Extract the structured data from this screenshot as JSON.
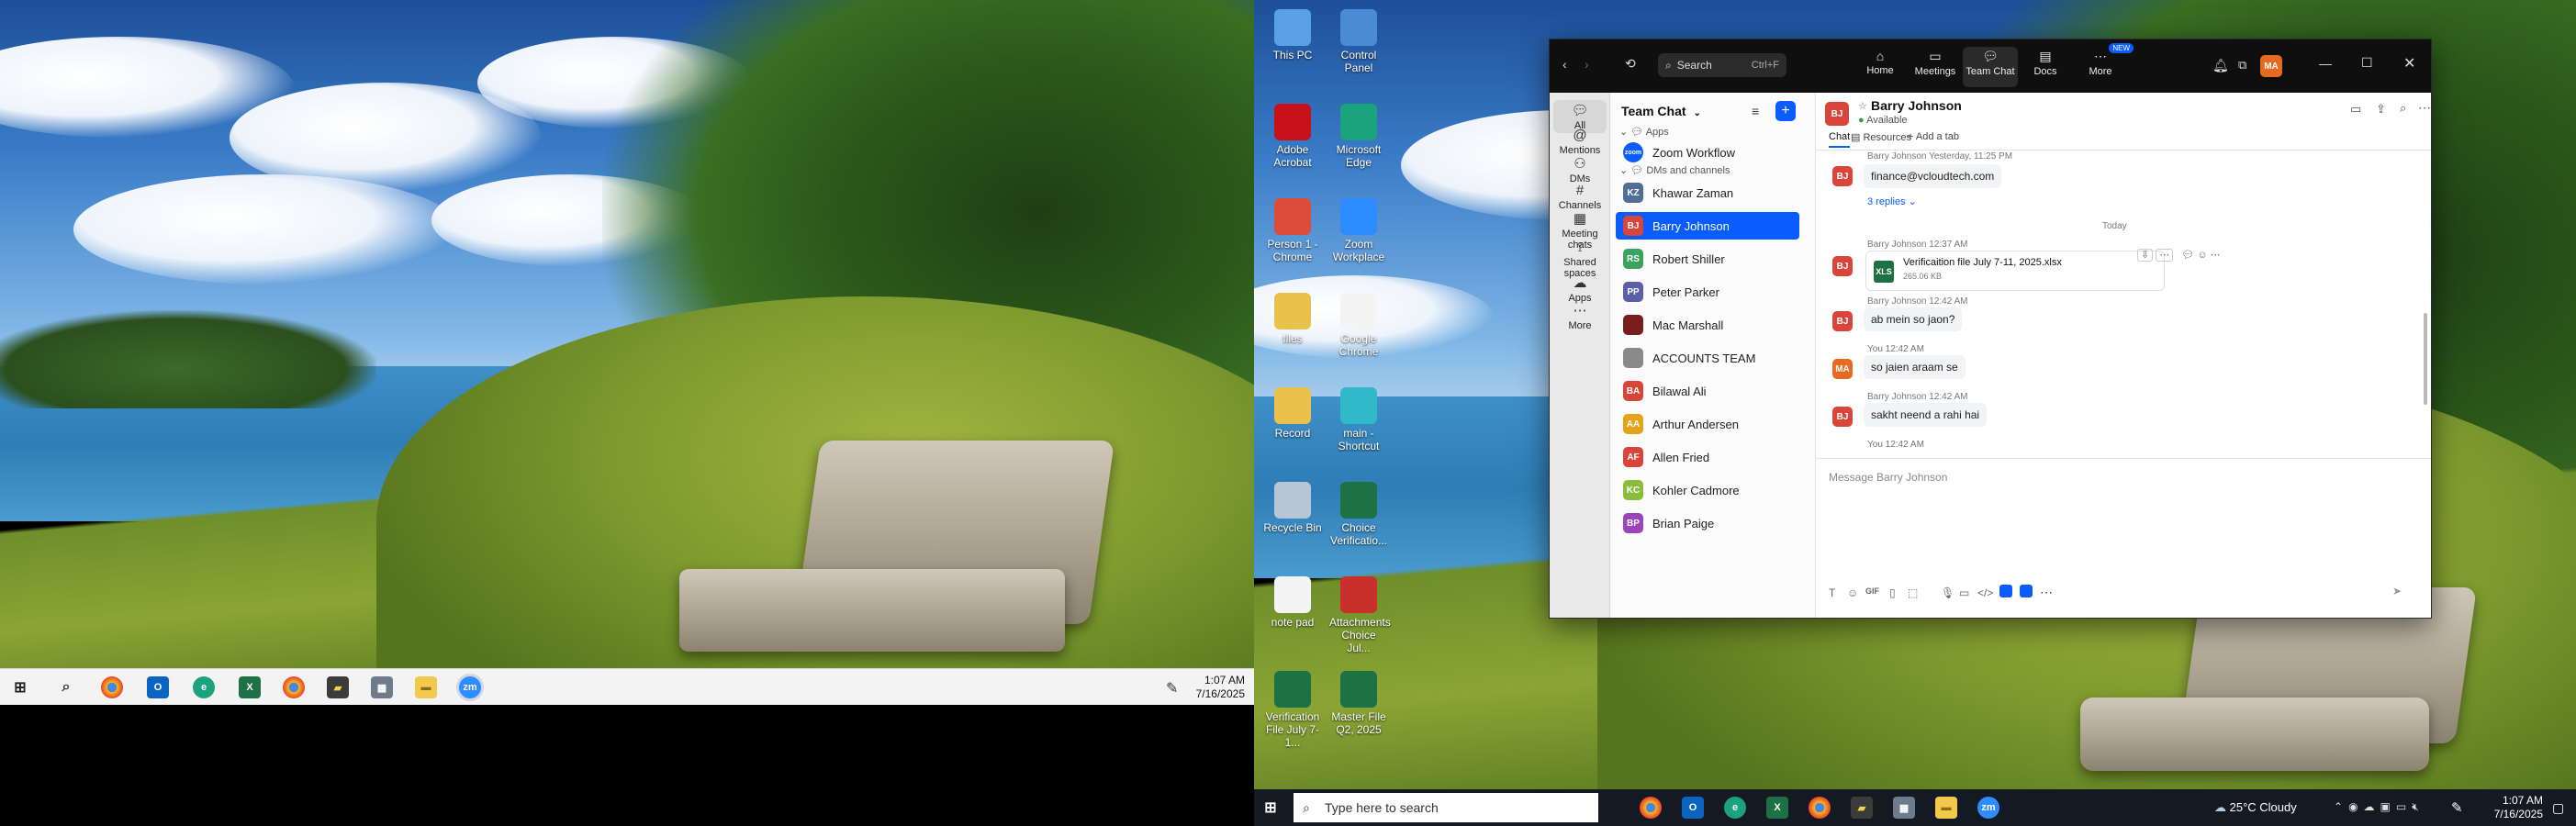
{
  "taskbar_left": {
    "clock_time": "1:07 AM",
    "clock_date": "7/16/2025",
    "apps": [
      {
        "icon": "windows-start-icon"
      },
      {
        "icon": "search-icon"
      },
      {
        "icon": "chrome-icon"
      },
      {
        "icon": "outlook-icon"
      },
      {
        "icon": "edge-icon"
      },
      {
        "icon": "excel-icon"
      },
      {
        "icon": "chrome-profile-icon"
      },
      {
        "icon": "sticky-notes-icon"
      },
      {
        "icon": "calculator-icon"
      },
      {
        "icon": "file-explorer-icon"
      },
      {
        "icon": "zoom-icon"
      }
    ]
  },
  "desktop_icons": [
    {
      "label": "This PC",
      "icon": "computer-icon",
      "color": "#5aa0e6"
    },
    {
      "label": "Control Panel",
      "icon": "control-panel-icon",
      "color": "#4b8bd6"
    },
    {
      "label": "Adobe Acrobat",
      "icon": "acrobat-icon",
      "color": "#c7101a"
    },
    {
      "label": "Microsoft Edge",
      "icon": "edge-icon",
      "color": "#1aa37c"
    },
    {
      "label": "Person 1 - Chrome",
      "icon": "chrome-icon",
      "color": "#dd4b39"
    },
    {
      "label": "Zoom Workplace",
      "icon": "zoom-icon",
      "color": "#2d8cff"
    },
    {
      "label": "files",
      "icon": "folder-icon",
      "color": "#e8c24a"
    },
    {
      "label": "Google Chrome",
      "icon": "document-icon",
      "color": "#f4f4f4"
    },
    {
      "label": "Record",
      "icon": "folder-icon",
      "color": "#e8c24a"
    },
    {
      "label": "main - Shortcut",
      "icon": "shortcut-icon",
      "color": "#2fb9c9"
    },
    {
      "label": "Recycle Bin",
      "icon": "recycle-bin-icon",
      "color": "#b7c6d6"
    },
    {
      "label": "Choice Verificatio...",
      "icon": "excel-icon",
      "color": "#1e7145"
    },
    {
      "label": "note pad",
      "icon": "notepad-icon",
      "color": "#f4f4f4"
    },
    {
      "label": "Attachments Choice Jul...",
      "icon": "folder-icon",
      "color": "#c9302c"
    },
    {
      "label": "Verification File July 7-1...",
      "icon": "excel-icon",
      "color": "#1e7145"
    },
    {
      "label": "Master File Q2, 2025",
      "icon": "excel-icon",
      "color": "#1e7145"
    }
  ],
  "taskbar_right": {
    "search_placeholder": "Type here to search",
    "weather": "25°C  Cloudy",
    "clock_time": "1:07 AM",
    "clock_date": "7/16/2025"
  },
  "zoom": {
    "search_label": "Search",
    "search_shortcut": "Ctrl+F",
    "nav_tabs": [
      {
        "label": "Home",
        "icon": "home-icon"
      },
      {
        "label": "Meetings",
        "icon": "video-icon"
      },
      {
        "label": "Team Chat",
        "icon": "chat-icon",
        "active": true
      },
      {
        "label": "Docs",
        "icon": "docs-icon"
      },
      {
        "label": "More",
        "icon": "more-icon",
        "badge": "NEW"
      }
    ],
    "profile_initials": "MA",
    "rail": [
      {
        "label": "All",
        "icon": "chat-bubble-icon"
      },
      {
        "label": "Mentions",
        "icon": "at-icon"
      },
      {
        "label": "DMs",
        "icon": "people-icon"
      },
      {
        "label": "Channels",
        "icon": "hash-icon"
      },
      {
        "label": "Meeting chats",
        "icon": "calendar-icon"
      },
      {
        "label": "Shared spaces",
        "icon": "shared-spaces-icon"
      },
      {
        "label": "Apps",
        "icon": "apps-icon"
      },
      {
        "label": "More",
        "icon": "ellipsis-icon"
      }
    ],
    "list_title": "Team Chat",
    "sections": {
      "apps": "Apps",
      "dms": "DMs and channels"
    },
    "app_item": "Zoom Workflow",
    "contacts": [
      {
        "name": "Khawar Zaman",
        "initials": "KZ",
        "color": "#4f6f95"
      },
      {
        "name": "Barry Johnson",
        "initials": "BJ",
        "color": "#d9453b",
        "active": true
      },
      {
        "name": "Robert Shiller",
        "initials": "RS",
        "color": "#3aa35d"
      },
      {
        "name": "Peter Parker",
        "initials": "PP",
        "color": "#5b5fa8"
      },
      {
        "name": "Mac Marshall",
        "initials": "",
        "color": "#7a1d1d"
      },
      {
        "name": "ACCOUNTS TEAM",
        "initials": "",
        "color": "#8a8a8a"
      },
      {
        "name": "Bilawal Ali",
        "initials": "BA",
        "color": "#d9453b"
      },
      {
        "name": "Arthur Andersen",
        "initials": "AA",
        "color": "#e6a21a"
      },
      {
        "name": "Allen Fried",
        "initials": "AF",
        "color": "#d9453b"
      },
      {
        "name": "Kohler Cadmore",
        "initials": "KC",
        "color": "#8bbd3c"
      },
      {
        "name": "Brian Paige",
        "initials": "BP",
        "color": "#9c45b8"
      }
    ],
    "chat": {
      "contact_name": "Barry Johnson",
      "contact_initials": "BJ",
      "status": "Available",
      "tabs": [
        "Chat",
        "Resources",
        "Add a tab"
      ],
      "messages": {
        "m0_meta": "Barry Johnson  Yesterday, 11:25 PM",
        "m0_text": "finance@vcloudtech.com",
        "m0_replies": "3 replies",
        "divider": "Today",
        "m1_meta": "Barry Johnson  12:37 AM",
        "m1_file": "Verificaition file July 7-11, 2025.xlsx",
        "m1_size": "265.06 KB",
        "m2_meta": "Barry Johnson  12:42 AM",
        "m2_text": "ab mein so jaon?",
        "m3_meta": "You  12:42 AM",
        "m3_text": "so jaien araam se",
        "m4_meta": "Barry Johnson  12:42 AM",
        "m4_text": "sakht neend a rahi hai",
        "m5_meta": "You  12:42 AM"
      },
      "composer_placeholder": "Message Barry Johnson",
      "gif_label": "GIF"
    }
  }
}
